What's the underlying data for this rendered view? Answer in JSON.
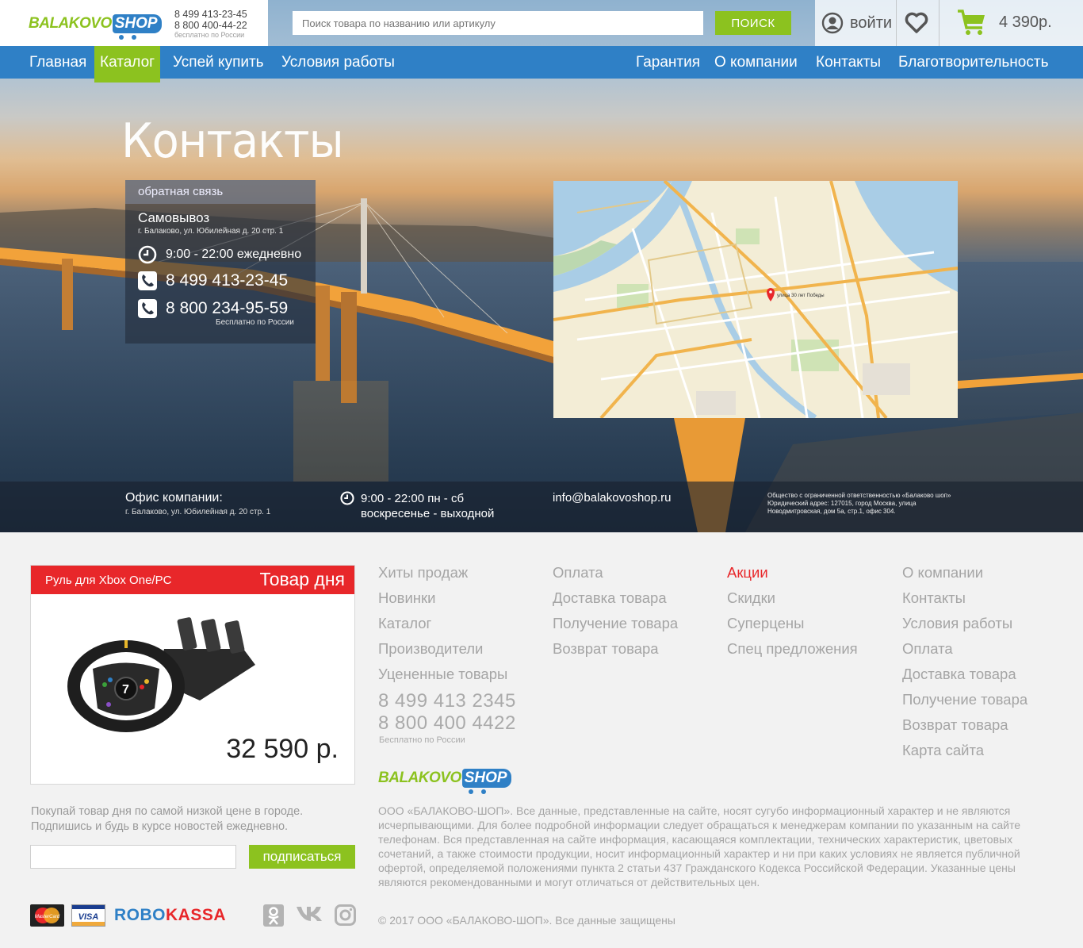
{
  "header": {
    "logo_part1": "BALAKOVO",
    "logo_part2": "SHOP",
    "phone1": "8 499 413-23-45",
    "phone2": "8 800 400-44-22",
    "phone_note": "бесплатно по России",
    "search_placeholder": "Поиск товара по названию или артикулу",
    "search_button": "поиск",
    "login": "войти",
    "cart_total": "4 390р."
  },
  "nav": {
    "left": [
      "Главная",
      "Каталог",
      "Успей купить",
      "Условия работы"
    ],
    "right": [
      "Гарантия",
      "О компании",
      "Контакты",
      "Благотворительность"
    ],
    "active": "Каталог"
  },
  "contacts": {
    "title": "Контакты",
    "feedback": "обратная связь",
    "pickup": "Самовывоз",
    "pickup_address": "г. Балаково, ул. Юбилейная д. 20 стр. 1",
    "hours": "9:00 - 22:00 ежедневно",
    "phone1": "8 499 413-23-45",
    "phone2": "8 800 234-95-59",
    "phone_note": "Бесплатно по России",
    "map_marker": "улица 30 лет Победы"
  },
  "office": {
    "title": "Офис компании:",
    "address": "г. Балаково, ул. Юбилейная д. 20 стр. 1",
    "hours_line1": "9:00 - 22:00 пн - сб",
    "hours_line2": "воскресенье - выходной",
    "email": "info@balakovoshop.ru",
    "legal": "Общество с ограниченной ответственностью «Балаково шоп» Юридический адрес: 127015, город Москва, улица Новодмитровская, дом 5а, стр.1, офис 304."
  },
  "deal": {
    "product_name": "Руль для Xbox One/PC",
    "label": "Товар дня",
    "price": "32 590 р.",
    "promo_text": "Покупай товар дня по самой низкой цене в городе. Подпишись и будь в курсе новостей ежедневно.",
    "subscribe_button": "подписаться"
  },
  "footer": {
    "col1": [
      "Хиты продаж",
      "Новинки",
      "Каталог",
      "Производители",
      "Уцененные товары"
    ],
    "col2": [
      "Оплата",
      "Доставка товара",
      "Получение товара",
      "Возврат товара"
    ],
    "col3": [
      "Акции",
      "Скидки",
      "Суперцены",
      "Спец предложения"
    ],
    "col4": [
      "О компании",
      "Контакты",
      "Условия работы",
      "Оплата",
      "Доставка товара",
      "Получение товара",
      "Возврат товара",
      "Карта сайта"
    ],
    "phone1": "8 499 413 2345",
    "phone2": "8 800 400 4422",
    "phone_note": "Бесплатно по России",
    "disclaimer": "ООО «БАЛАКОВО-ШОП». Все данные, представленные на сайте, носят сугубо информационный характер и не являются исчерпывающими. Для более подробной информации следует обращаться к менеджерам компании по указанным на сайте телефонам. Вся представленная на сайте информация, касающаяся комплектации, технических характеристик, цветовых сочетаний, а также стоимости продукции, носит информационный характер и ни при каких условиях не является публичной офертой, определяемой положениями пункта 2 статьи 437 Гражданского Кодекса Российской Федерации. Указанные цены являются рекомендованными и могут отличаться от действительных цен.",
    "copyright": "© 2017 ООО «БАЛАКОВО-ШОП». Все данные защищены",
    "payment_mastercard": "MasterCard",
    "payment_visa": "VISA",
    "payment_robo_a": "ROBO",
    "payment_robo_b": "KASSA",
    "social": [
      "odnoklassniki-icon",
      "vk-icon",
      "instagram-icon"
    ]
  },
  "colors": {
    "brand_blue": "#2f80c6",
    "brand_green": "#8cc21f",
    "accent_red": "#e8272a"
  }
}
